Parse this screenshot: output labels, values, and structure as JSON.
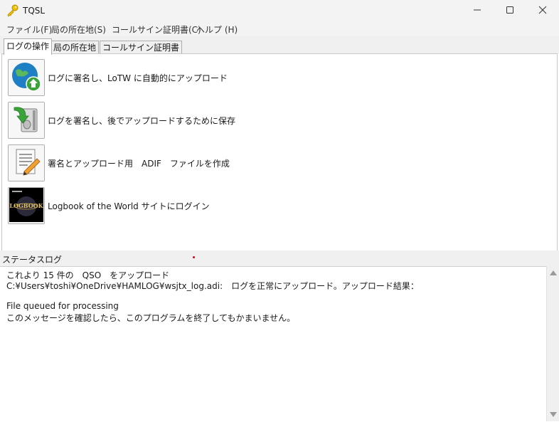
{
  "window": {
    "title": "TQSL",
    "icons": {
      "app": "key-icon",
      "minimize": "minimize-icon",
      "maximize": "maximize-icon",
      "close": "close-icon"
    }
  },
  "menu": [
    "ファイル(F)",
    "局の所在地(S)",
    "コールサイン証明書(C)",
    "ヘルプ (H)"
  ],
  "tabs": [
    {
      "label": "ログの操作",
      "active": true
    },
    {
      "label": "局の所在地",
      "active": false
    },
    {
      "label": "コールサイン証明書",
      "active": false
    }
  ],
  "actions": [
    {
      "label": "ログに署名し、LoTW に自動的にアップロード",
      "icon": "globe-upload-icon"
    },
    {
      "label": "ログを署名し、後でアップロードするために保存",
      "icon": "save-disk-icon"
    },
    {
      "label": "署名とアップロード用　ADIF　ファイルを作成",
      "icon": "edit-document-icon"
    },
    {
      "label": "Logbook of the World サイトにログイン",
      "icon": "lotw-logo-icon",
      "logo_text": "LOGBOOK"
    }
  ],
  "status": {
    "title": "ステータスログ",
    "lines": [
      "これより 15 件の　QSO　をアップロード",
      "C:¥Users¥toshi¥OneDrive¥HAMLOG¥wsjtx_log.adi:　ログを正常にアップロード。アップロード結果：",
      "",
      "File queued for processing",
      "このメッセージを確認したら、このプログラムを終了してもかまいません。"
    ]
  },
  "colors": {
    "chrome": "#f3f3f3",
    "panel": "#ffffff",
    "accent_dot": "#e0001a"
  }
}
